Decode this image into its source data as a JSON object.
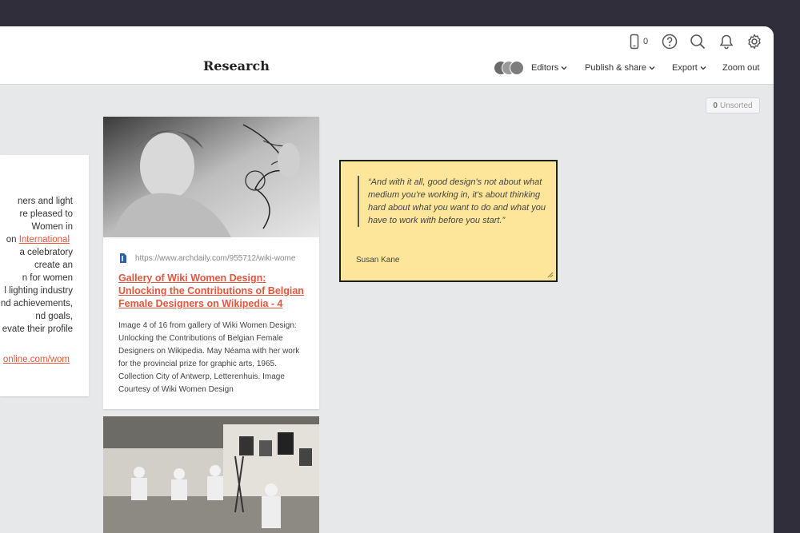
{
  "header": {
    "title": "Research",
    "device_count": "0",
    "icons": [
      "device-icon",
      "help-icon",
      "search-icon",
      "bell-icon",
      "gear-icon"
    ],
    "menus": {
      "editors": "Editors",
      "publish": "Publish & share",
      "export": "Export",
      "zoom": "Zoom out"
    }
  },
  "unsorted": {
    "count": "0",
    "label": "Unsorted"
  },
  "left_card": {
    "lines": [
      "ners and light",
      "re pleased to",
      "Women in",
      "on ",
      "a celebratory",
      "create an",
      "n for women",
      "l lighting industry",
      "nd achievements,",
      "nd goals,",
      "evate their profile"
    ],
    "link_text": "International ",
    "url": "online.com/wom"
  },
  "article": {
    "source_url": "https://www.archdaily.com/955712/wiki-wome",
    "title": "Gallery of Wiki Women Design: Unlocking the Contributions of Belgian Female Designers on Wikipedia - 4",
    "description": "Image 4 of 16 from gallery of Wiki Women Design: Unlocking the Contributions of Belgian Female Designers on Wikipedia. May Néama with her work for the provincial prize for graphic arts, 1965. Collection City of Antwerp, Letterenhuis. Image Courtesy of Wiki Women Design"
  },
  "note": {
    "quote": "“And with it all, good design's not about what medium you're working in, it's about thinking hard about what you want to do and what you have to work with before you start.”",
    "author": "Susan Kane"
  },
  "colors": {
    "accent": "#e2573f",
    "note_bg": "#fde69a",
    "canvas": "#e7e8ea",
    "frame": "#2f2e3a"
  }
}
